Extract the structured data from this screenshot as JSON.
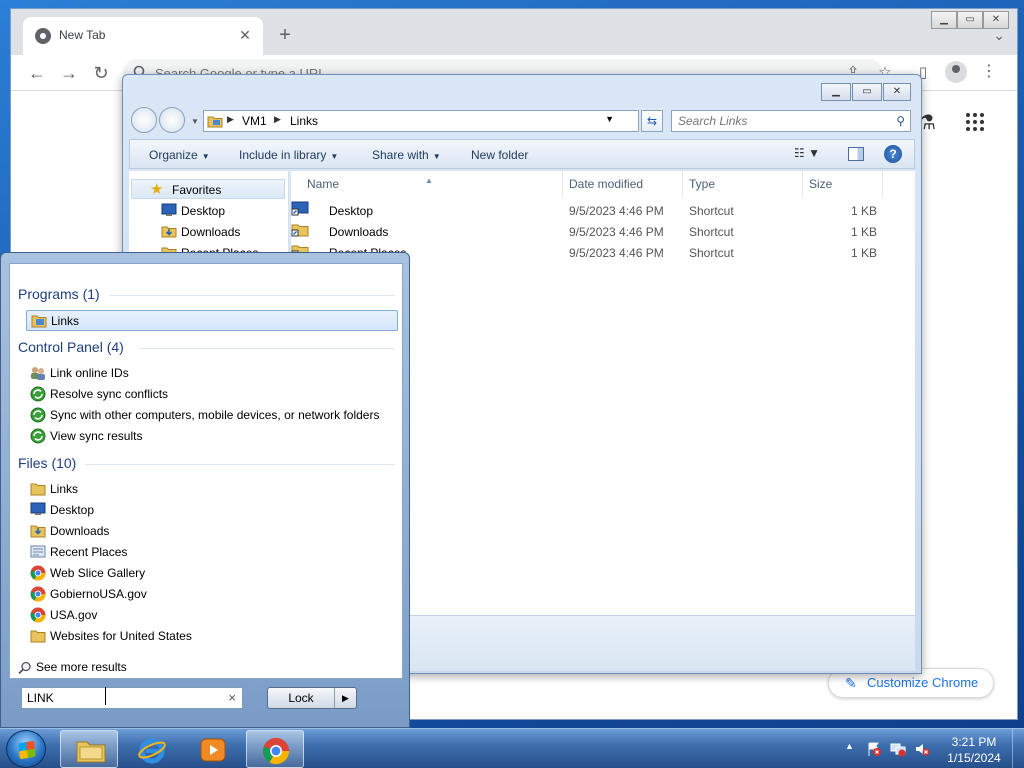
{
  "chrome": {
    "tab_title": "New Tab",
    "tab_close": "✕",
    "new_tab": "+",
    "omnibox_placeholder": "Search Google or type a URL",
    "customize_label": "Customize Chrome",
    "caption": {
      "minimize": "▁",
      "maximize": "▭",
      "close": "✕"
    }
  },
  "explorer": {
    "breadcrumb": [
      "VM1",
      "Links"
    ],
    "search_placeholder": "Search Links",
    "commands": {
      "organize": "Organize",
      "include_in_library": "Include in library",
      "share_with": "Share with",
      "new_folder": "New folder"
    },
    "nav": {
      "favorites": "Favorites",
      "desktop": "Desktop",
      "downloads": "Downloads",
      "recent_places": "Recent Places"
    },
    "columns": {
      "name": "Name",
      "date": "Date modified",
      "type": "Type",
      "size": "Size"
    },
    "files": [
      {
        "name": "Desktop",
        "date": "9/5/2023 4:46 PM",
        "type": "Shortcut",
        "size": "1 KB"
      },
      {
        "name": "Downloads",
        "date": "9/5/2023 4:46 PM",
        "type": "Shortcut",
        "size": "1 KB"
      },
      {
        "name": "Recent Places",
        "date": "9/5/2023 4:46 PM",
        "type": "Shortcut",
        "size": "1 KB"
      }
    ]
  },
  "startmenu": {
    "programs_heading": "Programs (1)",
    "programs": [
      "Links"
    ],
    "control_panel_heading": "Control Panel (4)",
    "control_panel": [
      "Link online IDs",
      "Resolve sync conflicts",
      "Sync with other computers, mobile devices, or network folders",
      "View sync results"
    ],
    "files_heading": "Files (10)",
    "files": [
      "Links",
      "Desktop",
      "Downloads",
      "Recent Places",
      "Web Slice Gallery",
      "GobiernoUSA.gov",
      "USA.gov",
      "Websites for United States"
    ],
    "see_more": "See more results",
    "search_value": "LINK",
    "clear": "×",
    "lock_label": "Lock",
    "lock_arrow": "▶"
  },
  "taskbar": {
    "time": "3:21 PM",
    "date": "1/15/2024"
  }
}
